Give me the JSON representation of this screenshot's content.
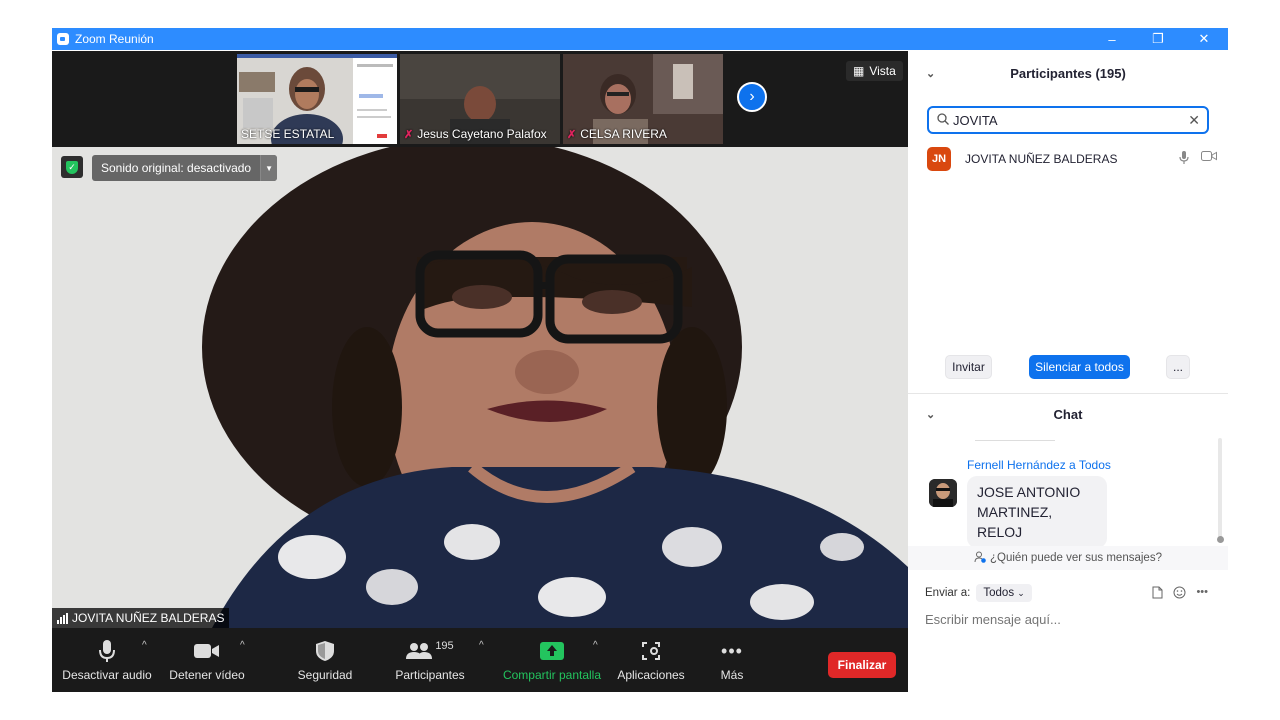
{
  "window": {
    "title": "Zoom Reunión",
    "controls": [
      "–",
      "❐",
      "✕"
    ]
  },
  "stage": {
    "thumbnails": [
      {
        "name": "SETSE ESTATAL",
        "muted": false
      },
      {
        "name": "Jesus Cayetano Palafox",
        "muted": true
      },
      {
        "name": "CELSA RIVERA",
        "muted": true
      }
    ],
    "view_label": "Vista",
    "sound_label": "Sonido original: desactivado",
    "speaker_name": "JOVITA NUÑEZ BALDERAS"
  },
  "toolbar": {
    "mute": "Desactivar audio",
    "video": "Detener vídeo",
    "security": "Seguridad",
    "participants": "Participantes",
    "participants_count": "195",
    "share": "Compartir pantalla",
    "apps": "Aplicaciones",
    "more": "Más",
    "end": "Finalizar"
  },
  "participants_panel": {
    "title": "Participantes (195)",
    "search_value": "JOVITA",
    "results": [
      {
        "initials": "JN",
        "name": "JOVITA NUÑEZ BALDERAS"
      }
    ],
    "invite": "Invitar",
    "mute_all": "Silenciar a todos",
    "more": "..."
  },
  "chat": {
    "title": "Chat",
    "messages": [
      {
        "sender": "Fernell Hernández a Todos",
        "text": "JOSE ANTONIO MARTINEZ, RELOJ"
      }
    ],
    "who_can_see": "¿Quién puede ver sus mensajes?",
    "send_to_label": "Enviar a:",
    "send_to_value": "Todos",
    "input_placeholder": "Escribir mensaje aquí..."
  },
  "colors": {
    "zoom_blue": "#2D8CFF",
    "accent_blue": "#0E72ED",
    "end_red": "#E02828",
    "share_green": "#23C45E",
    "avatar_orange": "#D9480F"
  }
}
